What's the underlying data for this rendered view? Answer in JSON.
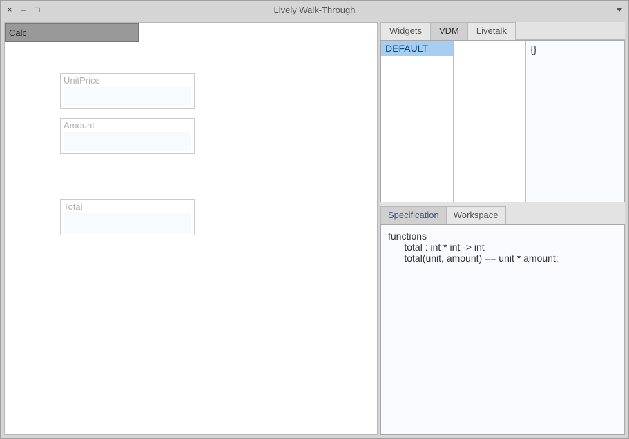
{
  "window": {
    "title": "Lively Walk-Through"
  },
  "canvas": {
    "widgets": {
      "unitprice": {
        "label": "UnitPrice",
        "value": ""
      },
      "amount": {
        "label": "Amount",
        "value": ""
      },
      "calc": {
        "label": "Calc"
      },
      "total": {
        "label": "Total",
        "value": ""
      }
    }
  },
  "rightPanel": {
    "tabs": {
      "widgets": "Widgets",
      "vdm": "VDM",
      "livetalk": "Livetalk",
      "active": "vdm"
    },
    "browser": {
      "col1": {
        "item": "DEFAULT"
      },
      "col3": {
        "text": "{}"
      }
    },
    "subTabs": {
      "specification": "Specification",
      "workspace": "Workspace",
      "active": "specification"
    },
    "specification": "functions\n      total : int * int -> int\n      total(unit, amount) == unit * amount;"
  }
}
